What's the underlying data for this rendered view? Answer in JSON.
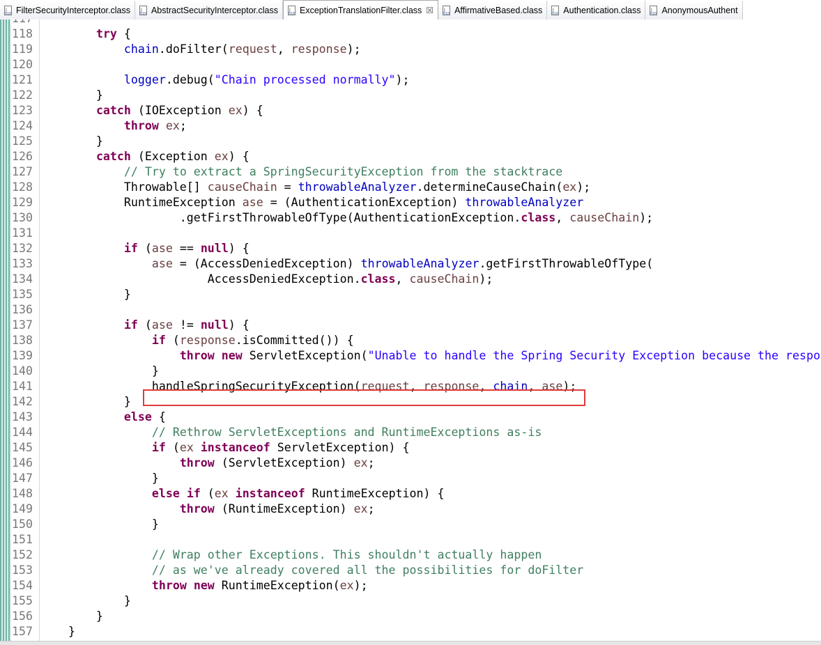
{
  "tabs": [
    {
      "label": "FilterSecurityInterceptor.class",
      "active": false
    },
    {
      "label": "AbstractSecurityInterceptor.class",
      "active": false
    },
    {
      "label": "ExceptionTranslationFilter.class",
      "active": true,
      "close": "☒"
    },
    {
      "label": "AffirmativeBased.class",
      "active": false
    },
    {
      "label": "Authentication.class",
      "active": false
    },
    {
      "label": "AnonymousAuthent",
      "active": false
    }
  ],
  "icon_names": {
    "tab_file": "class-file-icon",
    "tab_close": "close-icon"
  },
  "colors": {
    "keyword": "#7f0055",
    "field": "#0000c0",
    "variable": "#6a3e3e",
    "string": "#2a00ff",
    "comment": "#3f7f5f",
    "line_number": "#787878",
    "highlight_box": "#e03b3b"
  },
  "highlighted_line": 141,
  "code_lines": [
    {
      "n": "117",
      "t": ""
    },
    {
      "n": "118",
      "t": "        try {"
    },
    {
      "n": "119",
      "t": "            chain.doFilter(request, response);"
    },
    {
      "n": "120",
      "t": ""
    },
    {
      "n": "121",
      "t": "            logger.debug(\"Chain processed normally\");"
    },
    {
      "n": "122",
      "t": "        }"
    },
    {
      "n": "123",
      "t": "        catch (IOException ex) {"
    },
    {
      "n": "124",
      "t": "            throw ex;"
    },
    {
      "n": "125",
      "t": "        }"
    },
    {
      "n": "126",
      "t": "        catch (Exception ex) {"
    },
    {
      "n": "127",
      "t": "            // Try to extract a SpringSecurityException from the stacktrace"
    },
    {
      "n": "128",
      "t": "            Throwable[] causeChain = throwableAnalyzer.determineCauseChain(ex);"
    },
    {
      "n": "129",
      "t": "            RuntimeException ase = (AuthenticationException) throwableAnalyzer"
    },
    {
      "n": "130",
      "t": "                    .getFirstThrowableOfType(AuthenticationException.class, causeChain);"
    },
    {
      "n": "131",
      "t": ""
    },
    {
      "n": "132",
      "t": "            if (ase == null) {"
    },
    {
      "n": "133",
      "t": "                ase = (AccessDeniedException) throwableAnalyzer.getFirstThrowableOfType("
    },
    {
      "n": "134",
      "t": "                        AccessDeniedException.class, causeChain);"
    },
    {
      "n": "135",
      "t": "            }"
    },
    {
      "n": "136",
      "t": ""
    },
    {
      "n": "137",
      "t": "            if (ase != null) {"
    },
    {
      "n": "138",
      "t": "                if (response.isCommitted()) {"
    },
    {
      "n": "139",
      "t": "                    throw new ServletException(\"Unable to handle the Spring Security Exception because the respo"
    },
    {
      "n": "140",
      "t": "                }"
    },
    {
      "n": "141",
      "t": "                handleSpringSecurityException(request, response, chain, ase);"
    },
    {
      "n": "142",
      "t": "            }"
    },
    {
      "n": "143",
      "t": "            else {"
    },
    {
      "n": "144",
      "t": "                // Rethrow ServletExceptions and RuntimeExceptions as-is"
    },
    {
      "n": "145",
      "t": "                if (ex instanceof ServletException) {"
    },
    {
      "n": "146",
      "t": "                    throw (ServletException) ex;"
    },
    {
      "n": "147",
      "t": "                }"
    },
    {
      "n": "148",
      "t": "                else if (ex instanceof RuntimeException) {"
    },
    {
      "n": "149",
      "t": "                    throw (RuntimeException) ex;"
    },
    {
      "n": "150",
      "t": "                }"
    },
    {
      "n": "151",
      "t": ""
    },
    {
      "n": "152",
      "t": "                // Wrap other Exceptions. This shouldn't actually happen"
    },
    {
      "n": "153",
      "t": "                // as we've already covered all the possibilities for doFilter"
    },
    {
      "n": "154",
      "t": "                throw new RuntimeException(ex);"
    },
    {
      "n": "155",
      "t": "            }"
    },
    {
      "n": "156",
      "t": "        }"
    },
    {
      "n": "157",
      "t": "    }"
    }
  ]
}
